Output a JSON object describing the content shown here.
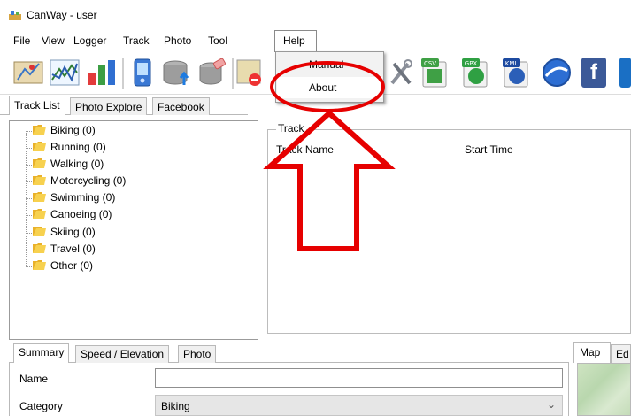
{
  "window": {
    "title": "CanWay - user"
  },
  "menu": {
    "items": [
      "File",
      "View",
      "Logger",
      "Track",
      "Photo",
      "Tool",
      "Help"
    ]
  },
  "help_menu": {
    "items": [
      {
        "label": "Manual"
      },
      {
        "label": "About"
      }
    ]
  },
  "toolbar": {
    "icons": [
      "map-view-icon",
      "chart-icon",
      "bar-chart-icon",
      "gps-device-icon",
      "database-upload-icon",
      "database-clear-icon",
      "map-remove-icon",
      "tools-icon",
      "csv-export-icon",
      "gpx-export-icon",
      "kml-export-icon",
      "google-earth-icon",
      "facebook-icon"
    ],
    "export_badges": {
      "csv": "CSV",
      "gpx": "GPX",
      "kml": "KML"
    },
    "facebook_glyph": "f"
  },
  "tabs": [
    "Track List",
    "Photo Explore",
    "Facebook"
  ],
  "tree": {
    "items": [
      {
        "label": "Biking (0)"
      },
      {
        "label": "Running (0)"
      },
      {
        "label": "Walking (0)"
      },
      {
        "label": "Motorcycling (0)"
      },
      {
        "label": "Swimming (0)"
      },
      {
        "label": "Canoeing (0)"
      },
      {
        "label": "Skiing (0)"
      },
      {
        "label": "Travel (0)"
      },
      {
        "label": "Other (0)"
      }
    ]
  },
  "track_panel": {
    "group_label": "Track",
    "columns": [
      "Track Name",
      "Start Time"
    ]
  },
  "bottom_tabs": [
    "Summary",
    "Speed / Elevation",
    "Photo"
  ],
  "summary": {
    "name_label": "Name",
    "name_value": "",
    "category_label": "Category",
    "category_value": "Biking"
  },
  "map_tabs": {
    "map": "Map",
    "ed": "Ed"
  },
  "colors": {
    "annotation_red": "#e60000",
    "folder_yellow": "#f2c230"
  }
}
